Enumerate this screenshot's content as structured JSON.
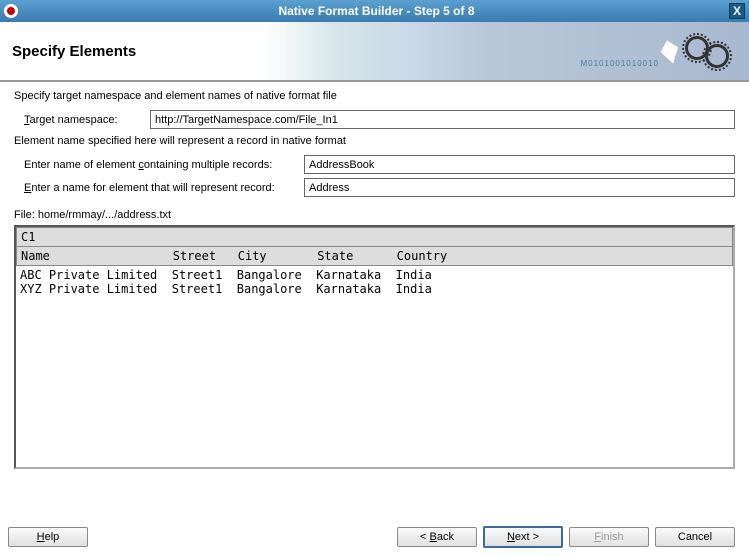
{
  "titlebar": {
    "title": "Native Format Builder - Step 5 of 8",
    "close_label": "X"
  },
  "header": {
    "title": "Specify Elements",
    "binary": "M0101001010010"
  },
  "form": {
    "instruction": "Specify target namespace and element names of native format file",
    "namespace_label_pre": "T",
    "namespace_label_rest": "arget namespace:",
    "namespace_value": "http://TargetNamespace.com/File_In1",
    "subtext": "Element name specified here will represent a record in native format",
    "container_label": "Enter name of element containing multiple records:",
    "container_underline": "c",
    "container_value": "AddressBook",
    "record_label_pre": "E",
    "record_label_rest": "nter a name for element that will represent record:",
    "record_value": "Address"
  },
  "preview": {
    "file_label": "File: home/rmmay/.../address.txt",
    "group_header": "C1",
    "columns": "Name                 Street   City       State      Country",
    "rows": [
      "ABC Private Limited  Street1  Bangalore  Karnataka  India",
      "XYZ Private Limited  Street1  Bangalore  Karnataka  India"
    ]
  },
  "footer": {
    "help": "Help",
    "help_underline": "H",
    "back": "< Back",
    "back_underline": "B",
    "next": "Next >",
    "next_underline": "N",
    "finish": "Finish",
    "finish_underline": "F",
    "cancel": "Cancel"
  }
}
